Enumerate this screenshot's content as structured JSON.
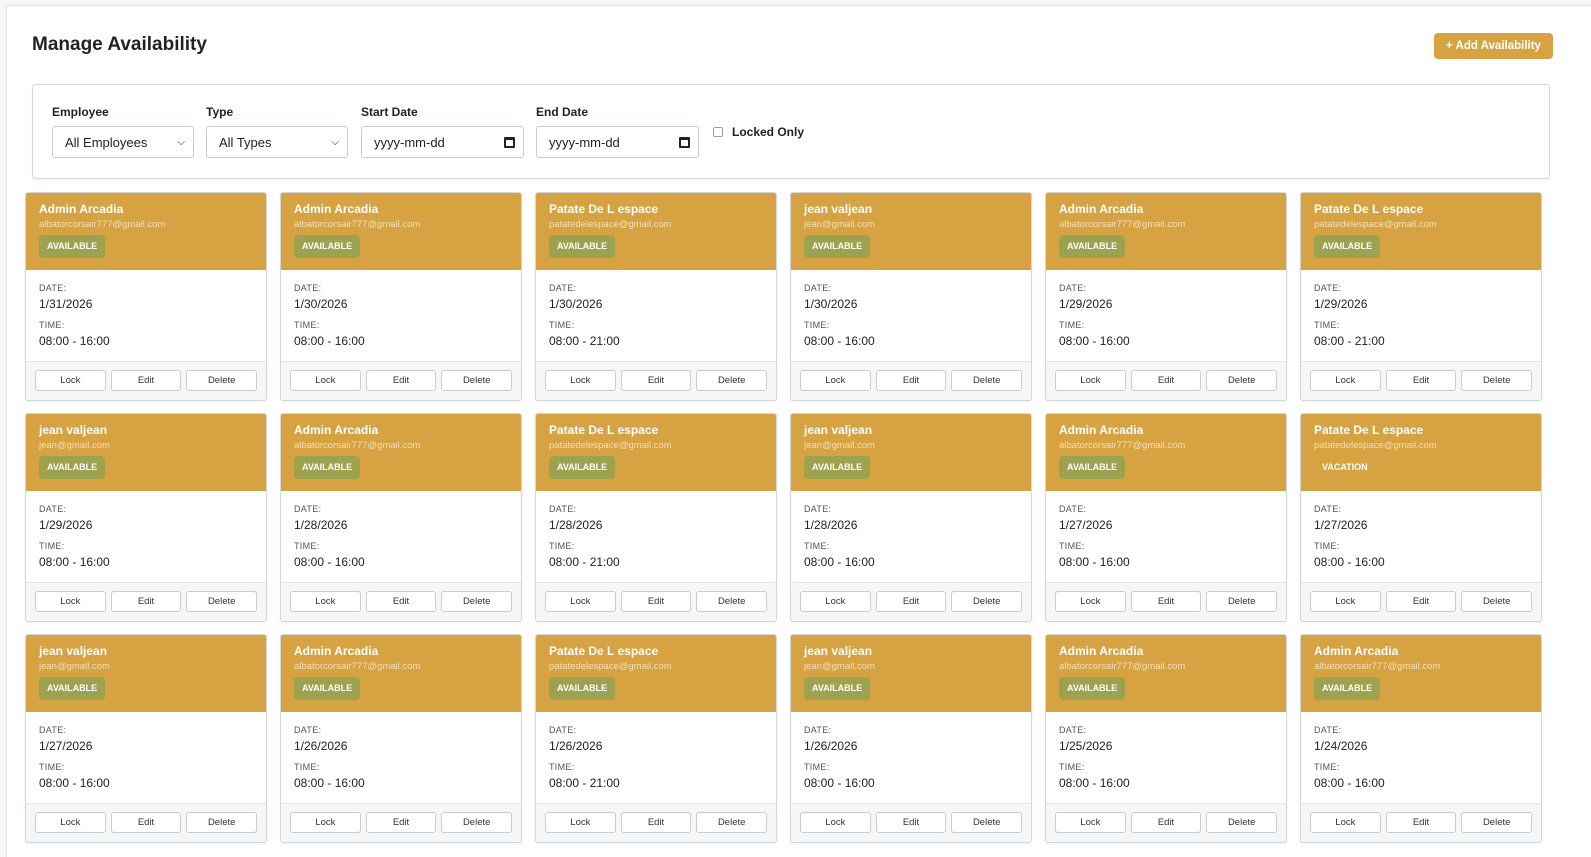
{
  "header": {
    "title": "Manage Availability",
    "add_button": "+ Add Availability"
  },
  "filters": {
    "employee": {
      "label": "Employee",
      "value": "All Employees"
    },
    "type": {
      "label": "Type",
      "value": "All Types"
    },
    "start_date": {
      "label": "Start Date",
      "placeholder": "yyyy-mm-dd"
    },
    "end_date": {
      "label": "End Date",
      "placeholder": "yyyy-mm-dd"
    },
    "locked_only": {
      "label": "Locked Only",
      "checked": false
    }
  },
  "labels": {
    "date": "DATE:",
    "time": "TIME:"
  },
  "actions": {
    "lock": "Lock",
    "edit": "Edit",
    "delete": "Delete"
  },
  "cards": [
    {
      "name": "Admin Arcadia",
      "email": "albatorcorsair777@gmail.com",
      "status": "AVAILABLE",
      "date": "1/31/2026",
      "time": "08:00 - 16:00"
    },
    {
      "name": "Admin Arcadia",
      "email": "albatorcorsair777@gmail.com",
      "status": "AVAILABLE",
      "date": "1/30/2026",
      "time": "08:00 - 16:00"
    },
    {
      "name": "Patate De L espace",
      "email": "patatedelespace@gmail.com",
      "status": "AVAILABLE",
      "date": "1/30/2026",
      "time": "08:00 - 21:00"
    },
    {
      "name": "jean valjean",
      "email": "jean@gmail.com",
      "status": "AVAILABLE",
      "date": "1/30/2026",
      "time": "08:00 - 16:00"
    },
    {
      "name": "Admin Arcadia",
      "email": "albatorcorsair777@gmail.com",
      "status": "AVAILABLE",
      "date": "1/29/2026",
      "time": "08:00 - 16:00"
    },
    {
      "name": "Patate De L espace",
      "email": "patatedelespace@gmail.com",
      "status": "AVAILABLE",
      "date": "1/29/2026",
      "time": "08:00 - 21:00"
    },
    {
      "name": "jean valjean",
      "email": "jean@gmail.com",
      "status": "AVAILABLE",
      "date": "1/29/2026",
      "time": "08:00 - 16:00"
    },
    {
      "name": "Admin Arcadia",
      "email": "albatorcorsair777@gmail.com",
      "status": "AVAILABLE",
      "date": "1/28/2026",
      "time": "08:00 - 16:00"
    },
    {
      "name": "Patate De L espace",
      "email": "patatedelespace@gmail.com",
      "status": "AVAILABLE",
      "date": "1/28/2026",
      "time": "08:00 - 21:00"
    },
    {
      "name": "jean valjean",
      "email": "jean@gmail.com",
      "status": "AVAILABLE",
      "date": "1/28/2026",
      "time": "08:00 - 16:00"
    },
    {
      "name": "Admin Arcadia",
      "email": "albatorcorsair777@gmail.com",
      "status": "AVAILABLE",
      "date": "1/27/2026",
      "time": "08:00 - 16:00"
    },
    {
      "name": "Patate De L espace",
      "email": "patatedelespace@gmail.com",
      "status": "VACATION",
      "date": "1/27/2026",
      "time": "08:00 - 16:00"
    },
    {
      "name": "jean valjean",
      "email": "jean@gmail.com",
      "status": "AVAILABLE",
      "date": "1/27/2026",
      "time": "08:00 - 16:00"
    },
    {
      "name": "Admin Arcadia",
      "email": "albatorcorsair777@gmail.com",
      "status": "AVAILABLE",
      "date": "1/26/2026",
      "time": "08:00 - 16:00"
    },
    {
      "name": "Patate De L espace",
      "email": "patatedelespace@gmail.com",
      "status": "AVAILABLE",
      "date": "1/26/2026",
      "time": "08:00 - 21:00"
    },
    {
      "name": "jean valjean",
      "email": "jean@gmail.com",
      "status": "AVAILABLE",
      "date": "1/26/2026",
      "time": "08:00 - 16:00"
    },
    {
      "name": "Admin Arcadia",
      "email": "albatorcorsair777@gmail.com",
      "status": "AVAILABLE",
      "date": "1/25/2026",
      "time": "08:00 - 16:00"
    },
    {
      "name": "Admin Arcadia",
      "email": "albatorcorsair777@gmail.com",
      "status": "AVAILABLE",
      "date": "1/24/2026",
      "time": "08:00 - 16:00"
    }
  ]
}
